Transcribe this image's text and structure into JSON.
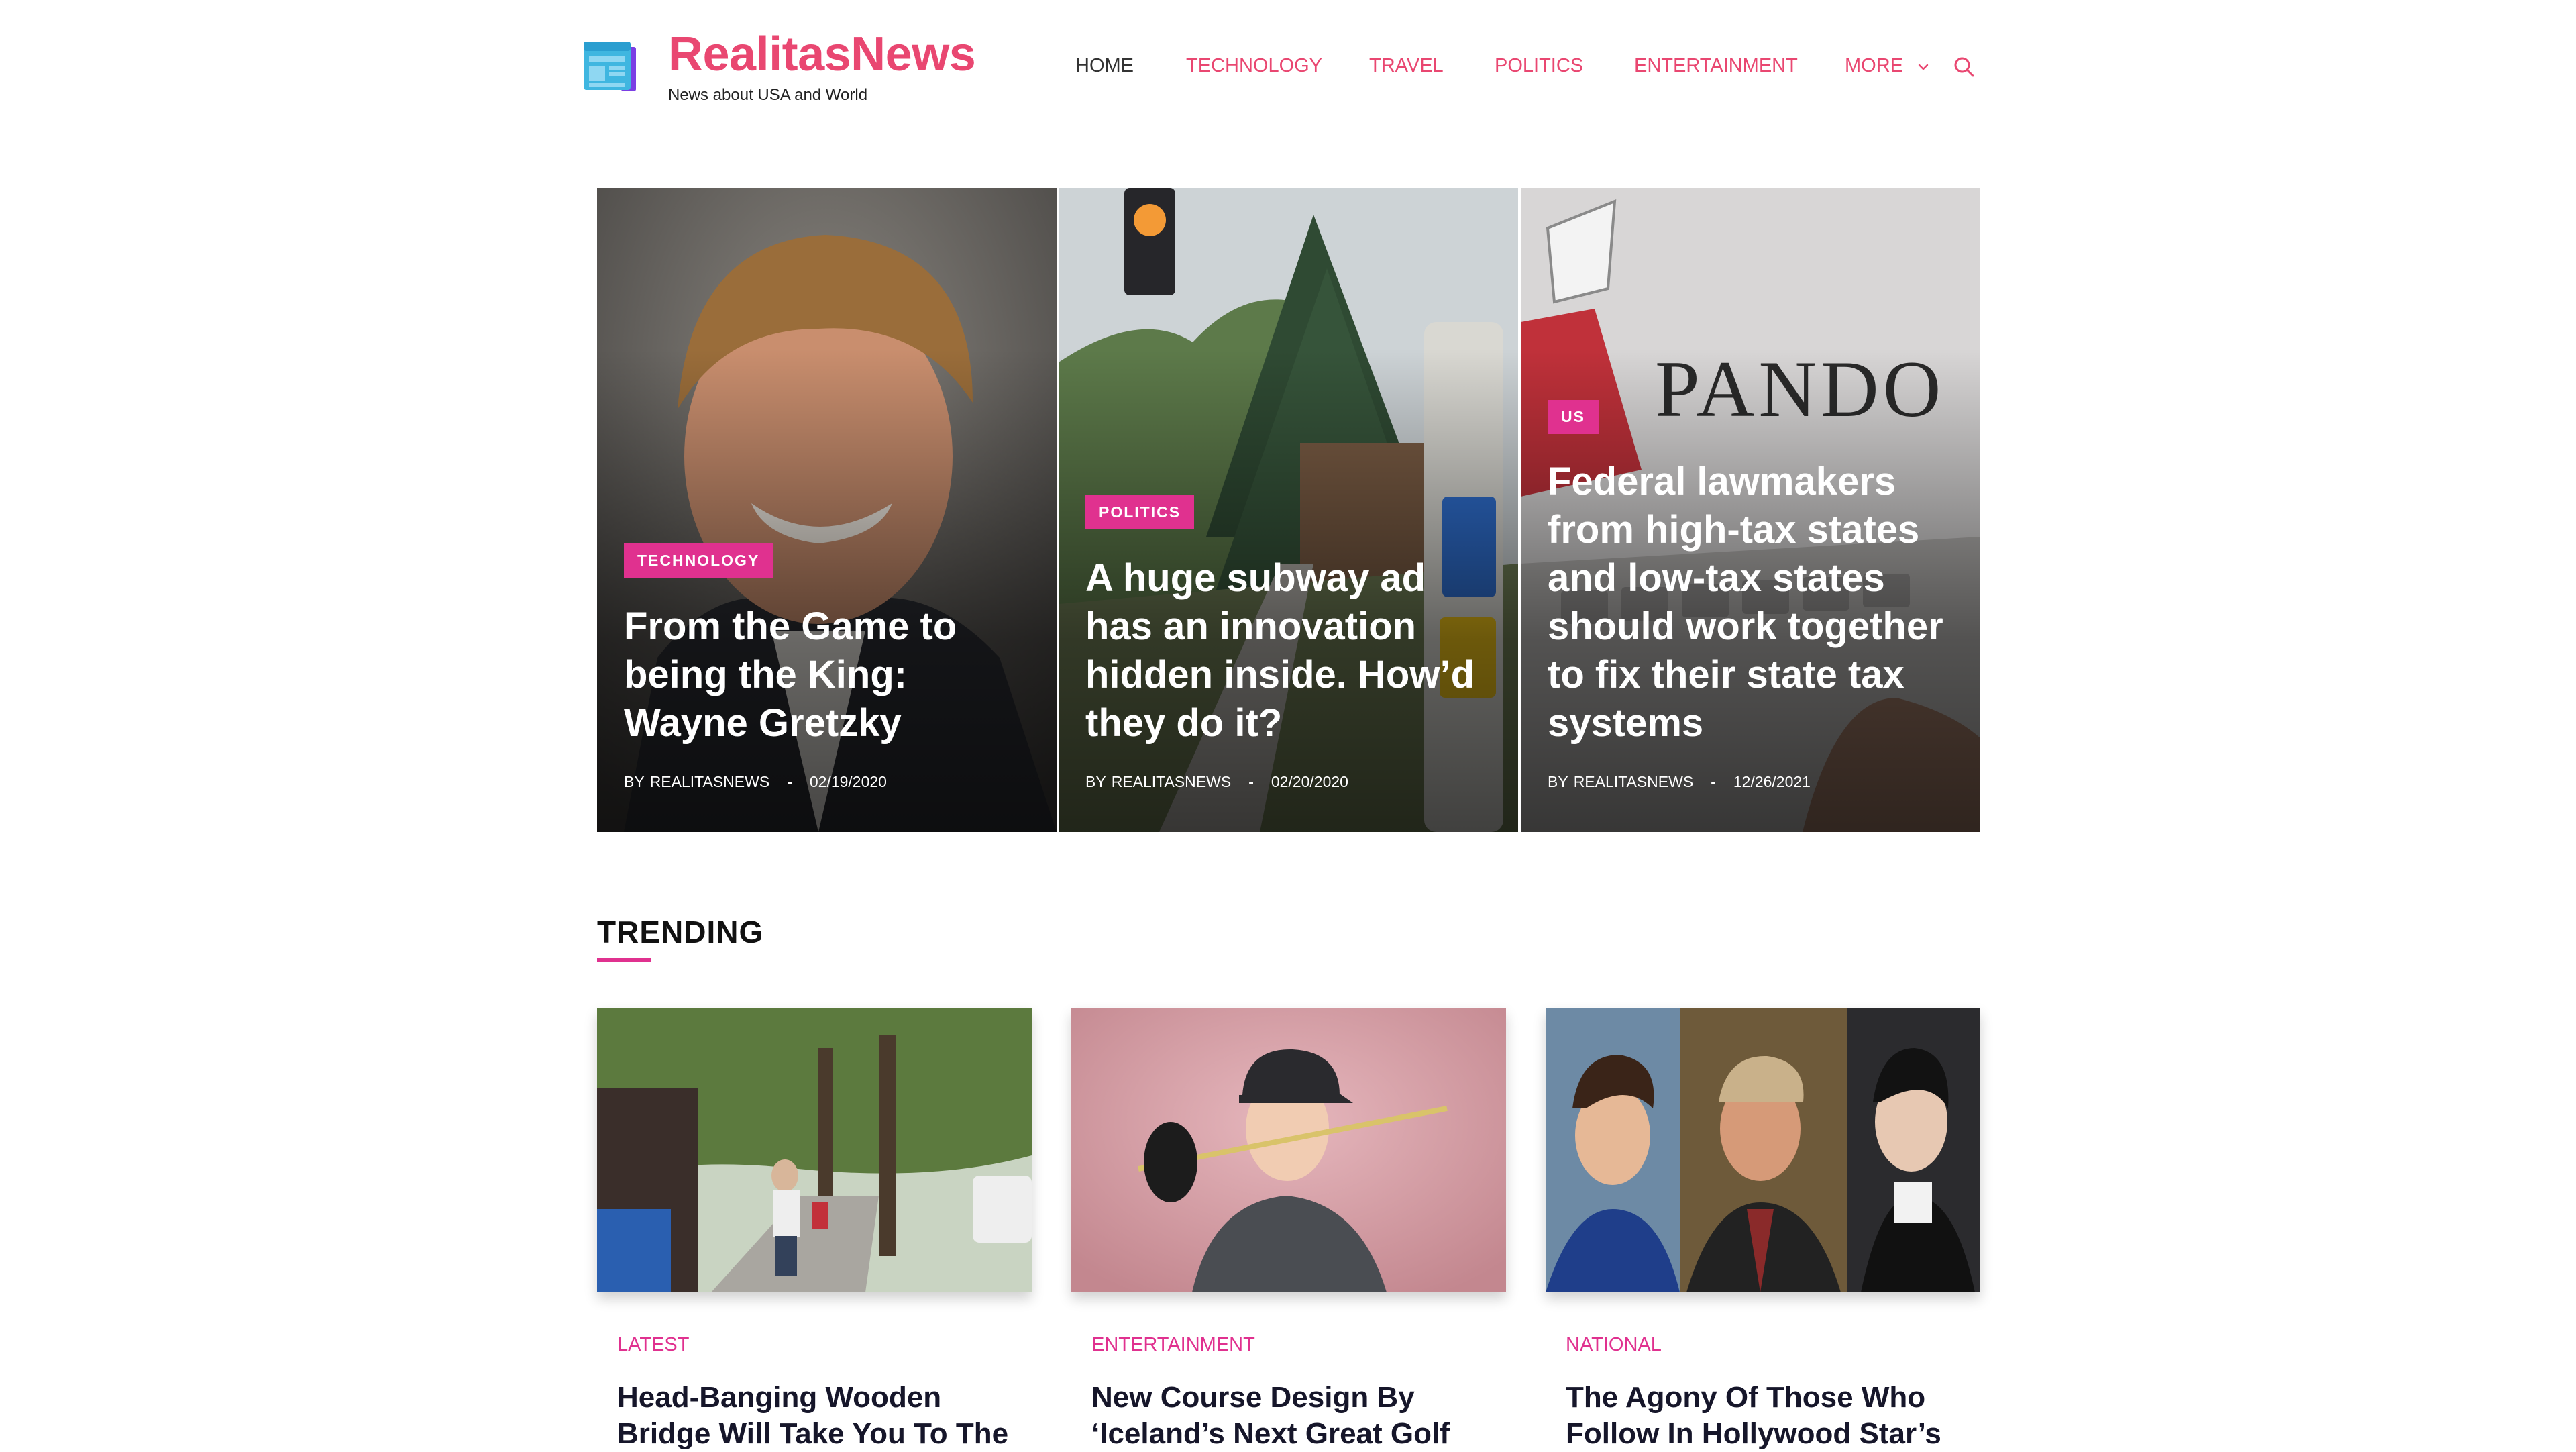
{
  "site": {
    "title": "RealitasNews",
    "tagline": "News about USA and World"
  },
  "nav": {
    "items": [
      "HOME",
      "TECHNOLOGY",
      "TRAVEL",
      "POLITICS",
      "ENTERTAINMENT",
      "MORE"
    ],
    "active": "HOME"
  },
  "icons": {
    "logo": "newspaper-icon",
    "more": "chevron-down-icon",
    "search": "search-icon"
  },
  "colors": {
    "brand": "#e94771",
    "accent": "#e0318f",
    "text": "#16162a"
  },
  "hero": {
    "cards": [
      {
        "category": "TECHNOLOGY",
        "title": "From the Game to being the King: Wayne Gretzky",
        "by": "BY",
        "author": "REALITASNEWS",
        "date": "02/19/2020"
      },
      {
        "category": "POLITICS",
        "title": "A huge subway ad has an innovation hidden inside. How’d they do it?",
        "by": "BY",
        "author": "REALITASNEWS",
        "date": "02/20/2020"
      },
      {
        "category": "US",
        "title": "Federal lawmakers from high-tax states and low-tax states should work together to fix their state tax systems",
        "by": "BY",
        "author": "REALITASNEWS",
        "date": "12/26/2021"
      }
    ]
  },
  "trending": {
    "heading": "TRENDING",
    "cards": [
      {
        "category": "LATEST",
        "title": "Head-Banging Wooden Bridge Will Take You To The"
      },
      {
        "category": "ENTERTAINMENT",
        "title": "New Course Design By ‘Iceland’s Next Great Golf"
      },
      {
        "category": "NATIONAL",
        "title": "The Agony Of Those Who Follow In Hollywood Star’s"
      }
    ]
  }
}
